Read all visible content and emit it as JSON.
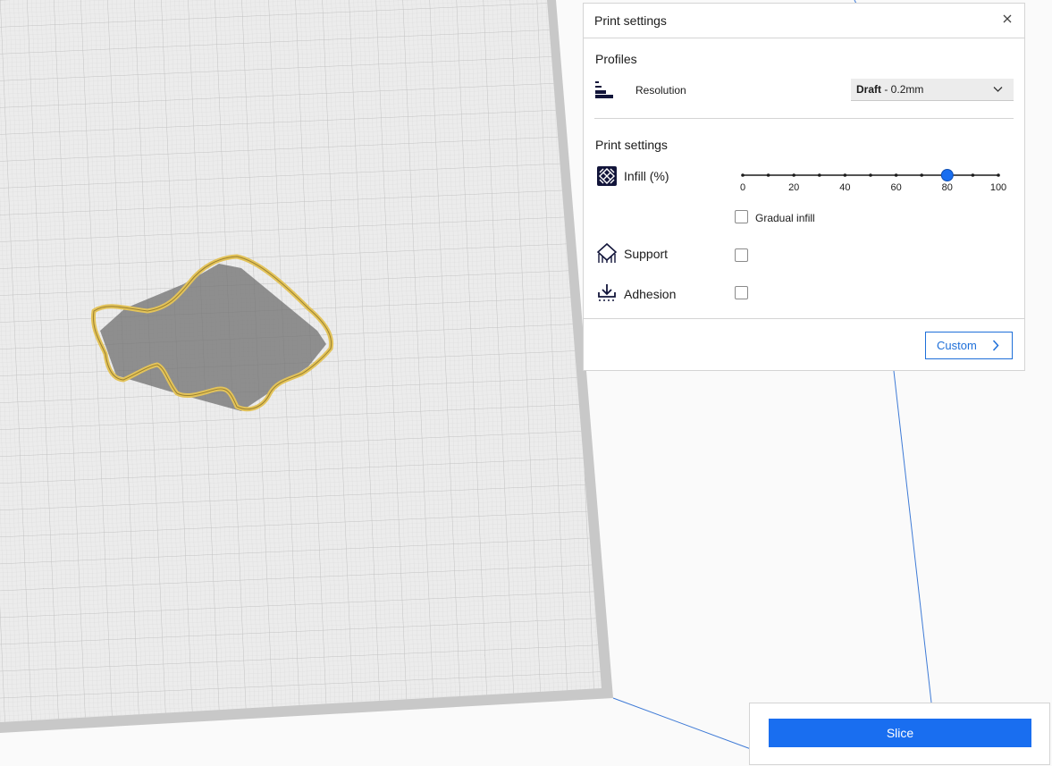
{
  "panel": {
    "title": "Print settings",
    "profiles_title": "Profiles",
    "resolution_label": "Resolution",
    "resolution_value_bold": "Draft",
    "resolution_value_rest": " - 0.2mm",
    "print_settings_title": "Print settings",
    "infill_label": "Infill (%)",
    "infill_value": 80,
    "infill_ticks": [
      "0",
      "20",
      "40",
      "60",
      "80",
      "100"
    ],
    "gradual_infill_label": "Gradual infill",
    "support_label": "Support",
    "adhesion_label": "Adhesion",
    "custom_label": "Custom"
  },
  "slice": {
    "label": "Slice"
  },
  "colors": {
    "accent": "#196ef0",
    "model_outline": "#e3c35a",
    "build_plate": "#e9e9e9"
  },
  "icons": [
    "close-icon",
    "resolution-icon",
    "infill-icon",
    "support-icon",
    "adhesion-icon",
    "chevron-down-icon",
    "chevron-right-icon"
  ]
}
